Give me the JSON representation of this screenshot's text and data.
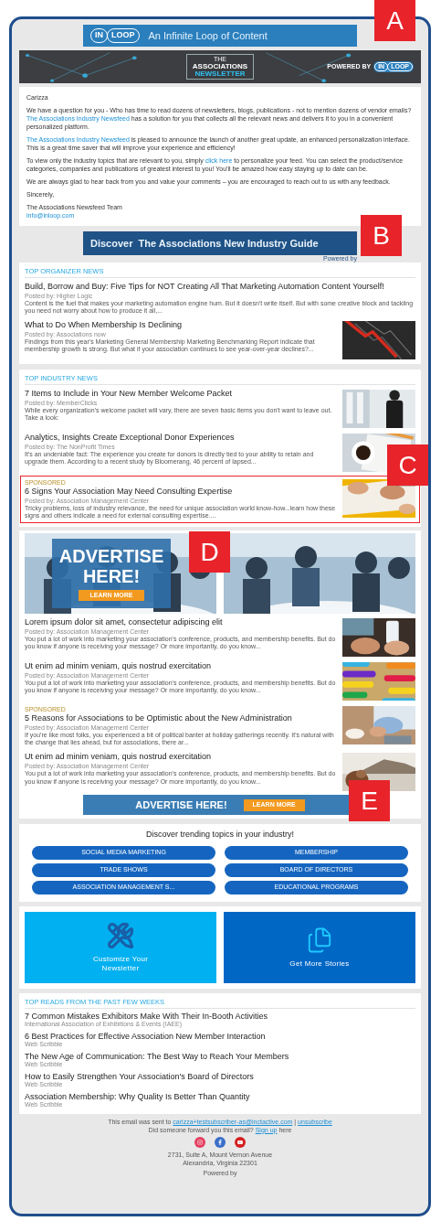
{
  "callouts": [
    {
      "letter": "A"
    },
    {
      "letter": "B"
    },
    {
      "letter": "C"
    },
    {
      "letter": "D"
    },
    {
      "letter": "E"
    }
  ],
  "logo": {
    "left": "IN",
    "right": "LOOP",
    "tagline": "An Infinite Loop of Content"
  },
  "header_banner": {
    "small": "THE",
    "line1": "ASSOCIATIONS",
    "line2": "NEWSLETTER",
    "powered_by": "POWERED BY",
    "logo_left": "IN",
    "logo_right": "LOOP"
  },
  "letter": {
    "greeting": "Carizza",
    "paragraphs": [
      [
        {
          "text": "We have a question for you - Who has time to read dozens of newsletters, blogs, publications - not to mention dozens of vendor emails? ",
          "kind": "text"
        },
        {
          "text": "The Associations Industry Newsfeed",
          "kind": "link"
        },
        {
          "text": " has a solution for you that collects all the relevant news and delivers it to you in a convenient personalized platform.",
          "kind": "text"
        }
      ],
      [
        {
          "text": "The Associations Industry Newsfeed",
          "kind": "link"
        },
        {
          "text": " is pleased to announce the launch of another great update, an enhanced personalization interface. This is a great time saver that will improve your experience and efficiency!",
          "kind": "text"
        }
      ],
      [
        {
          "text": "To view only the industry topics that are relevant to you, simply ",
          "kind": "text"
        },
        {
          "text": "click here",
          "kind": "link"
        },
        {
          "text": " to personalize your feed. You can select the product/service categories, companies and publications of greatest interest to you! You'll be amazed how easy staying up to date can be.",
          "kind": "text"
        }
      ],
      [
        {
          "text": "We are always glad to hear back from you and value your comments – you are encouraged to reach out to us with any feedback.",
          "kind": "text"
        }
      ]
    ],
    "closing": "Sincerely,",
    "signature": "The Associations Newsfeed Team",
    "email": "info@inloop.com"
  },
  "guide_banner": {
    "text": "Discover  The Associations New Industry Guide",
    "powered": "Powered by"
  },
  "organizer_news": {
    "heading": "TOP ORGANIZER NEWS",
    "articles": [
      {
        "kind": "text-only",
        "highlighted": false,
        "title": "Build, Borrow and Buy: Five Tips for NOT Creating All That Marketing Automation Content Yourself!",
        "posted": "Posted by: Higher Logic",
        "excerpt": "Content is the fuel that makes your marketing automation engine hum. But it doesn't write itself. But with some creative block and tackling you need not worry about how to produce it all,..."
      },
      {
        "kind": "with-picture",
        "highlighted": false,
        "title": "What to Do When Membership Is Declining",
        "posted": "Posted by: Associations now",
        "excerpt": "Findings from this year's Marketing General Membership Marketing Benchmarking Report indicate that membership growth is strong. But what if your association continues to see year-over-year declines?..."
      }
    ]
  },
  "industry_news": {
    "heading": "TOP INDUSTRY NEWS",
    "articles": [
      {
        "kind": "with-picture",
        "highlighted": false,
        "title": "7 Items to Include in Your New Member Welcome Packet",
        "posted": "Posted by: MemberClicks",
        "excerpt": "While every organization's welcome packet will vary, there are seven basic items you don't want to leave out. Take a look:"
      },
      {
        "kind": "with-picture",
        "highlighted": false,
        "title": "Analytics, Insights Create Exceptional Donor Experiences",
        "posted": "Posted by: The NonProfit Times",
        "excerpt": "It's an undeniable fact: The experience you create for donors is directly tied to your ability to retain and upgrade them. According to a recent study by Bloomerang, 46 percent of lapsed..."
      },
      {
        "kind": "with-picture",
        "highlighted": true,
        "label": "SPONSORED",
        "title": "6 Signs Your Association May Need Consulting Expertise",
        "posted": "Posted by: Association Management Center",
        "excerpt": "Tricky problems, loss of industry relevance, the need for unique association world know-how...learn how these signs and others indicate a need for external consulting expertise...."
      }
    ]
  },
  "ad_tile": {
    "headline": "ADVERTISE HERE!",
    "button": "LEARN MORE"
  },
  "more_articles": [
    {
      "kind": "with-picture",
      "highlighted": false,
      "title": "Lorem ipsum dolor sit amet, consectetur adipiscing elit",
      "posted": "Posted by: Association Management Center",
      "excerpt": "You put a lot of work into marketing your association's conference, products, and membership benefits. But do you know if anyone is receiving your message? Or more importantly, do you know..."
    },
    {
      "kind": "with-picture",
      "highlighted": false,
      "title": "Ut enim ad minim veniam, quis nostrud exercitation",
      "posted": "Posted by: Association Management Center",
      "excerpt": "You put a lot of work into marketing your association's conference, products, and membership benefits. But do you know if anyone is receiving your message? Or more importantly, do you know..."
    },
    {
      "kind": "with-picture",
      "highlighted": false,
      "label": "SPONSORED",
      "title": "5 Reasons for Associations to be Optimistic about the New Administration",
      "posted": "Posted by: Association Management Center",
      "excerpt": "If you're like most folks, you experienced a bit of political banter at holiday gatherings recently. It's natural with the change that lies ahead, but for associations, there ar..."
    },
    {
      "kind": "with-picture",
      "highlighted": false,
      "title": "Ut enim ad minim veniam, quis nostrud exercitation",
      "posted": "Posted by: Association Management Center",
      "excerpt": "You put a lot of work into marketing your association's conference, products, and membership benefits. But do you know if anyone is receiving your message? Or more importantly, do you know..."
    }
  ],
  "ad_banner": {
    "headline": "ADVERTISE HERE!",
    "button": "LEARN MORE"
  },
  "trending": {
    "title": "Discover trending topics in your industry!",
    "topics": [
      "SOCIAL MEDIA MARKETING",
      "MEMBERSHIP",
      "TRADE SHOWS",
      "BOARD OF DIRECTORS",
      "ASSOCIATION MANAGEMENT S...",
      "EDUCATIONAL PROGRAMS"
    ]
  },
  "tiles": [
    {
      "kind": "tools",
      "label": "Customize Your Newsletter",
      "color": "#00b0f0"
    },
    {
      "kind": "documents",
      "label": "Get More Stories",
      "color": "#0067c5"
    }
  ],
  "top_reads": {
    "heading": "TOP READS FROM THE PAST FEW WEEKS",
    "items": [
      {
        "title": "7 Common Mistakes Exhibitors Make With Their In-Booth Activities",
        "source": "International Association of Exhibitions & Events (IAEE)"
      },
      {
        "title": "6 Best Practices for Effective Association New Member Interaction",
        "source": "Web Scribble"
      },
      {
        "title": "The New Age of Communication: The Best Way to Reach Your Members",
        "source": "Web Scribble"
      },
      {
        "title": "How to Easily Strengthen Your Association's Board of Directors",
        "source": "Web Scribble"
      },
      {
        "title": "Association Membership: Why Quality Is Better Than Quantity",
        "source": "Web Scribble"
      }
    ]
  },
  "footer": {
    "sent": [
      {
        "text": "This email was sent to ",
        "kind": "text"
      },
      {
        "text": "carizza+testsubscriber-as@inctactive.com",
        "kind": "link"
      },
      {
        "text": " | ",
        "kind": "text"
      },
      {
        "text": "unsubscribe",
        "kind": "link"
      }
    ],
    "forward": [
      {
        "text": "Did someone forward you this email? ",
        "kind": "text"
      },
      {
        "text": "Sign up",
        "kind": "link"
      },
      {
        "text": " here",
        "kind": "text"
      }
    ],
    "social": [
      {
        "kind": "instagram",
        "color": "#e4405f"
      },
      {
        "kind": "facebook",
        "color": "#3b6fc9"
      },
      {
        "kind": "youtube",
        "color": "#d42121"
      }
    ],
    "address": [
      "2731, Suite A, Mount Vernon Avenue",
      "Alexandria, Virginia 22301"
    ],
    "powered": "Powered by"
  }
}
